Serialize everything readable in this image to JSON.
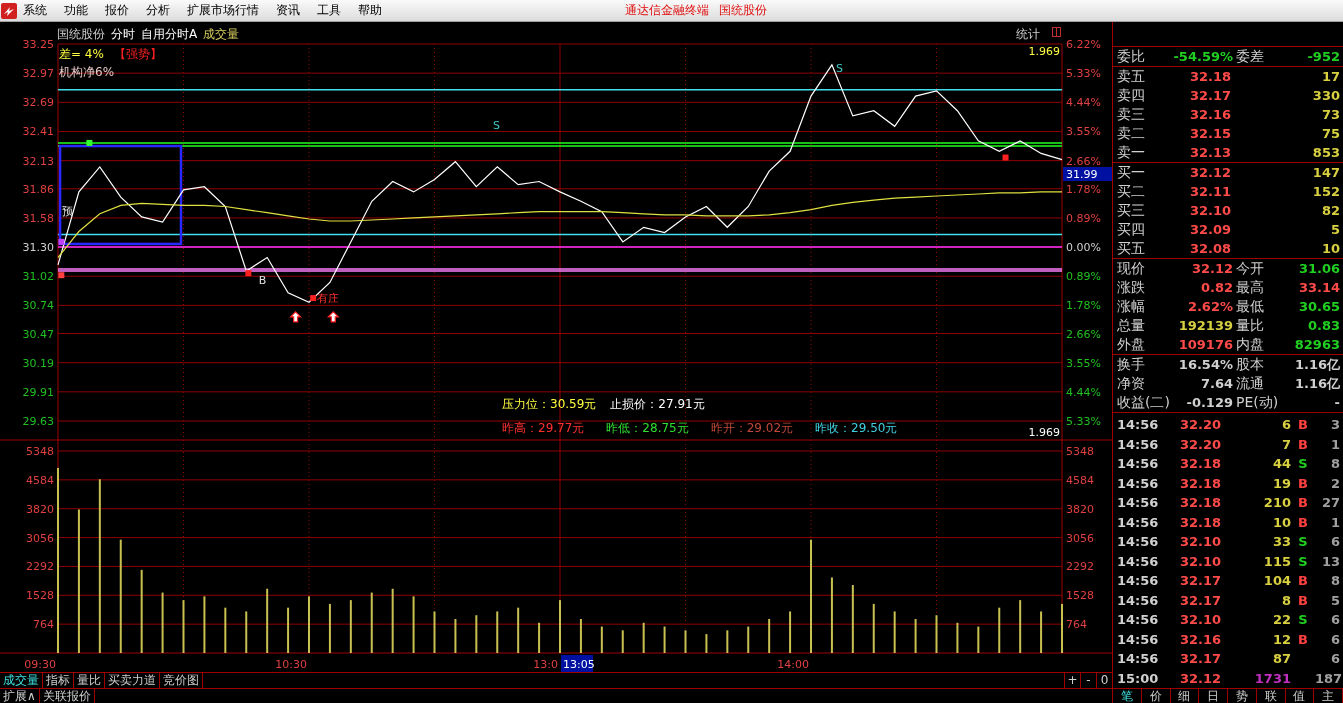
{
  "menu": {
    "items": [
      "系统",
      "功能",
      "报价",
      "分析",
      "扩展市场行情",
      "资讯",
      "工具",
      "帮助"
    ],
    "center": [
      "通达信金融终端",
      "国统股份"
    ]
  },
  "chart_header": {
    "stock": "国统股份",
    "period": "分时",
    "template": "自用分时A",
    "indicator": "成交量",
    "stats_button": "统计"
  },
  "price_panel": {
    "diff_label": "差= 4%",
    "trend_label": "【强势】",
    "institution_label": "机构净6%",
    "top_value": "1.969",
    "bottom_value": "1.969",
    "cursor_price": "31.99",
    "right_axis": [
      "6.22%",
      "5.33%",
      "4.44%",
      "3.55%",
      "2.66%",
      "1.78%",
      "0.89%",
      "0.00%",
      "0.89%",
      "1.78%",
      "2.66%",
      "3.55%",
      "4.44%",
      "5.33%"
    ],
    "signal_labels": [
      "S",
      "S",
      "预",
      "B",
      "有庄"
    ],
    "stats_rows": [
      {
        "items": [
          {
            "text": "压力位：30.59元",
            "color": "#ffff40"
          },
          {
            "text": "止损价：27.91元",
            "color": "#ffffff"
          }
        ]
      },
      {
        "items": [
          {
            "text": "昨高：29.77元",
            "color": "#ff3030"
          },
          {
            "text": "昨低：28.75元",
            "color": "#30e030"
          },
          {
            "text": "昨开：29.02元",
            "color": "#c04838"
          },
          {
            "text": "昨收：29.50元",
            "color": "#40d0e0"
          }
        ]
      }
    ],
    "chart_data": {
      "type": "line",
      "categories": [
        null,
        null,
        null,
        null,
        null,
        null,
        null,
        null,
        null,
        null,
        null,
        null,
        null,
        null,
        null,
        null,
        null,
        null,
        null,
        null,
        null,
        null,
        null,
        null,
        null,
        null,
        null,
        null,
        null,
        null,
        null,
        null,
        null,
        null,
        null,
        null,
        null,
        null,
        null,
        null,
        null,
        null,
        null,
        null,
        null,
        null,
        null,
        null,
        null
      ],
      "series": [
        {
          "color": "#ffffff",
          "values": [
            31.13,
            31.83,
            32.07,
            31.78,
            31.59,
            31.54,
            31.85,
            31.88,
            31.69,
            31.07,
            31.2,
            30.86,
            30.77,
            30.96,
            31.35,
            31.74,
            31.93,
            31.83,
            31.95,
            32.12,
            31.88,
            32.07,
            31.9,
            31.93,
            31.83,
            31.74,
            31.64,
            31.35,
            31.49,
            31.44,
            31.59,
            31.69,
            31.49,
            31.69,
            32.03,
            32.22,
            32.75,
            33.05,
            32.56,
            32.61,
            32.46,
            32.75,
            32.8,
            32.61,
            32.32,
            32.22,
            32.32,
            32.2,
            32.14
          ]
        },
        {
          "color": "#e0e040",
          "values": [
            31.2,
            31.45,
            31.62,
            31.7,
            31.72,
            31.71,
            31.7,
            31.7,
            31.69,
            31.66,
            31.63,
            31.6,
            31.57,
            31.55,
            31.55,
            31.56,
            31.57,
            31.58,
            31.59,
            31.6,
            31.61,
            31.62,
            31.63,
            31.64,
            31.64,
            31.64,
            31.64,
            31.63,
            31.62,
            31.61,
            31.61,
            31.6,
            31.6,
            31.6,
            31.61,
            31.63,
            31.66,
            31.7,
            31.73,
            31.75,
            31.77,
            31.78,
            31.79,
            31.8,
            31.81,
            31.82,
            31.82,
            31.83,
            31.83
          ]
        }
      ],
      "ylim": [
        29.63,
        33.25
      ],
      "yticks": [
        {
          "value": 33.25,
          "label": "33.25"
        },
        {
          "value": 32.97,
          "label": "32.97"
        },
        {
          "value": 32.69,
          "label": "32.69"
        },
        {
          "value": 32.41,
          "label": "32.41"
        },
        {
          "value": 32.13,
          "label": "32.13"
        },
        {
          "value": 31.86,
          "label": "31.86"
        },
        {
          "value": 31.58,
          "label": "31.58"
        },
        {
          "value": 31.3,
          "label": "31.30"
        },
        {
          "value": 31.02,
          "label": "31.02"
        },
        {
          "value": 30.74,
          "label": "30.74"
        },
        {
          "value": 30.47,
          "label": "30.47"
        },
        {
          "value": 30.19,
          "label": "30.19"
        },
        {
          "value": 29.91,
          "label": "29.91"
        },
        {
          "value": 29.63,
          "label": "29.63"
        }
      ]
    }
  },
  "volume_panel": {
    "right_yticks": [
      "5348",
      "4584",
      "3820",
      "3056",
      "2292",
      "1528",
      "764"
    ],
    "cursor_time": "13:05",
    "time_axis": [
      "09:30",
      "10:30",
      "13:0",
      "14:00"
    ],
    "chart_data": {
      "type": "bar",
      "categories": [
        null,
        null,
        null,
        null,
        null,
        null,
        null,
        null,
        null,
        null,
        null,
        null,
        null,
        null,
        null,
        null,
        null,
        null,
        null,
        null,
        null,
        null,
        null,
        null,
        null,
        null,
        null,
        null,
        null,
        null,
        null,
        null,
        null,
        null,
        null,
        null,
        null,
        null,
        null,
        null,
        null,
        null,
        null,
        null,
        null,
        null,
        null,
        null,
        null
      ],
      "series": [
        {
          "color": "#c8c050",
          "values": [
            4900,
            3800,
            4600,
            3000,
            2200,
            1600,
            1400,
            1500,
            1200,
            1100,
            1700,
            1200,
            1500,
            1300,
            1400,
            1600,
            1700,
            1500,
            1100,
            900,
            1000,
            1100,
            1200,
            800,
            1400,
            900,
            700,
            600,
            800,
            700,
            600,
            500,
            600,
            700,
            900,
            1100,
            3000,
            2000,
            1800,
            1300,
            1100,
            900,
            1000,
            800,
            700,
            1200,
            1400,
            1100,
            1300
          ]
        }
      ],
      "ylim": [
        0,
        5348
      ],
      "yticks": [
        {
          "value": 5348,
          "label": "5348"
        },
        {
          "value": 4584,
          "label": "4584"
        },
        {
          "value": 3820,
          "label": "3820"
        },
        {
          "value": 3056,
          "label": "3056"
        },
        {
          "value": 2292,
          "label": "2292"
        },
        {
          "value": 1528,
          "label": "1528"
        },
        {
          "value": 764,
          "label": "764"
        }
      ]
    }
  },
  "chart_tabs": [
    {
      "label": "成交量",
      "selected": true
    },
    {
      "label": "指标",
      "selected": false
    },
    {
      "label": "量比",
      "selected": false
    },
    {
      "label": "买卖力道",
      "selected": false
    },
    {
      "label": "竞价图",
      "selected": false
    }
  ],
  "zoom_controls": [
    "+",
    "-",
    "0"
  ],
  "bottom_tabs": [
    "扩展∧",
    "关联报价"
  ],
  "order_ratio": {
    "label": "委比",
    "value": "-54.59%",
    "label2": "委差",
    "value2": "-952"
  },
  "asks": [
    {
      "label": "卖五",
      "price": "32.18",
      "volume": "17"
    },
    {
      "label": "卖四",
      "price": "32.17",
      "volume": "330"
    },
    {
      "label": "卖三",
      "price": "32.16",
      "volume": "73"
    },
    {
      "label": "卖二",
      "price": "32.15",
      "volume": "75"
    },
    {
      "label": "卖一",
      "price": "32.13",
      "volume": "853"
    }
  ],
  "bids": [
    {
      "label": "买一",
      "price": "32.12",
      "volume": "147"
    },
    {
      "label": "买二",
      "price": "32.11",
      "volume": "152"
    },
    {
      "label": "买三",
      "price": "32.10",
      "volume": "82"
    },
    {
      "label": "买四",
      "price": "32.09",
      "volume": "5"
    },
    {
      "label": "买五",
      "price": "32.08",
      "volume": "10"
    }
  ],
  "quote": [
    {
      "label": "现价",
      "value": "32.12",
      "color": "#ff4a4a"
    },
    {
      "label": "今开",
      "value": "31.06",
      "color": "#20d020"
    },
    {
      "label": "涨跌",
      "value": "0.82",
      "color": "#ff4a4a"
    },
    {
      "label": "最高",
      "value": "33.14",
      "color": "#ff4a4a"
    },
    {
      "label": "涨幅",
      "value": "2.62%",
      "color": "#ff4a4a"
    },
    {
      "label": "最低",
      "value": "30.65",
      "color": "#20d020"
    },
    {
      "label": "总量",
      "value": "192139",
      "color": "#d8d040"
    },
    {
      "label": "量比",
      "value": "0.83",
      "color": "#20d020"
    },
    {
      "label": "外盘",
      "value": "109176",
      "color": "#ff4a4a"
    },
    {
      "label": "内盘",
      "value": "82963",
      "color": "#20d020"
    }
  ],
  "fundamentals": [
    {
      "label": "换手",
      "value": "16.54%",
      "label2": "股本",
      "value2": "1.16亿"
    },
    {
      "label": "净资",
      "value": "7.64",
      "label2": "流通",
      "value2": "1.16亿"
    },
    {
      "label": "收益(二)",
      "value": "-0.129",
      "label2": "PE(动)",
      "value2": "-"
    }
  ],
  "ticks": [
    {
      "time": "14:56",
      "price": "32.20",
      "volume": {
        "text": "6",
        "color": "#d8d040"
      },
      "side": {
        "text": "B",
        "color": "#ff4040"
      },
      "count": "3"
    },
    {
      "time": "14:56",
      "price": "32.20",
      "volume": {
        "text": "7",
        "color": "#d8d040"
      },
      "side": {
        "text": "B",
        "color": "#ff4040"
      },
      "count": "1"
    },
    {
      "time": "14:56",
      "price": "32.18",
      "volume": {
        "text": "44",
        "color": "#d8d040"
      },
      "side": {
        "text": "S",
        "color": "#20d020"
      },
      "count": "8"
    },
    {
      "time": "14:56",
      "price": "32.18",
      "volume": {
        "text": "19",
        "color": "#d8d040"
      },
      "side": {
        "text": "B",
        "color": "#ff4040"
      },
      "count": "2"
    },
    {
      "time": "14:56",
      "price": "32.18",
      "volume": {
        "text": "210",
        "color": "#d8d040"
      },
      "side": {
        "text": "B",
        "color": "#ff4040"
      },
      "count": "27"
    },
    {
      "time": "14:56",
      "price": "32.18",
      "volume": {
        "text": "10",
        "color": "#d8d040"
      },
      "side": {
        "text": "B",
        "color": "#ff4040"
      },
      "count": "1"
    },
    {
      "time": "14:56",
      "price": "32.10",
      "volume": {
        "text": "33",
        "color": "#d8d040"
      },
      "side": {
        "text": "S",
        "color": "#20d020"
      },
      "count": "6"
    },
    {
      "time": "14:56",
      "price": "32.10",
      "volume": {
        "text": "115",
        "color": "#d8d040"
      },
      "side": {
        "text": "S",
        "color": "#20d020"
      },
      "count": "13"
    },
    {
      "time": "14:56",
      "price": "32.17",
      "volume": {
        "text": "104",
        "color": "#d8d040"
      },
      "side": {
        "text": "B",
        "color": "#ff4040"
      },
      "count": "8"
    },
    {
      "time": "14:56",
      "price": "32.17",
      "volume": {
        "text": "8",
        "color": "#d8d040"
      },
      "side": {
        "text": "B",
        "color": "#ff4040"
      },
      "count": "5"
    },
    {
      "time": "14:56",
      "price": "32.10",
      "volume": {
        "text": "22",
        "color": "#d8d040"
      },
      "side": {
        "text": "S",
        "color": "#20d020"
      },
      "count": "6"
    },
    {
      "time": "14:56",
      "price": "32.16",
      "volume": {
        "text": "12",
        "color": "#d8d040"
      },
      "side": {
        "text": "B",
        "color": "#ff4040"
      },
      "count": "6"
    },
    {
      "time": "14:56",
      "price": "32.17",
      "volume": {
        "text": "87",
        "color": "#d8d040"
      },
      "count": "6"
    },
    {
      "time": "15:00",
      "price": "32.12",
      "volume": {
        "text": "1731",
        "color": "#c030c0"
      },
      "count": "187"
    }
  ],
  "panel_tabs": [
    {
      "label": "笔",
      "selected": true
    },
    {
      "label": "价",
      "selected": false
    },
    {
      "label": "细",
      "selected": false
    },
    {
      "label": "日",
      "selected": false
    },
    {
      "label": "势",
      "selected": false
    },
    {
      "label": "联",
      "selected": false
    },
    {
      "label": "值",
      "selected": false
    },
    {
      "label": "主",
      "selected": false
    }
  ]
}
